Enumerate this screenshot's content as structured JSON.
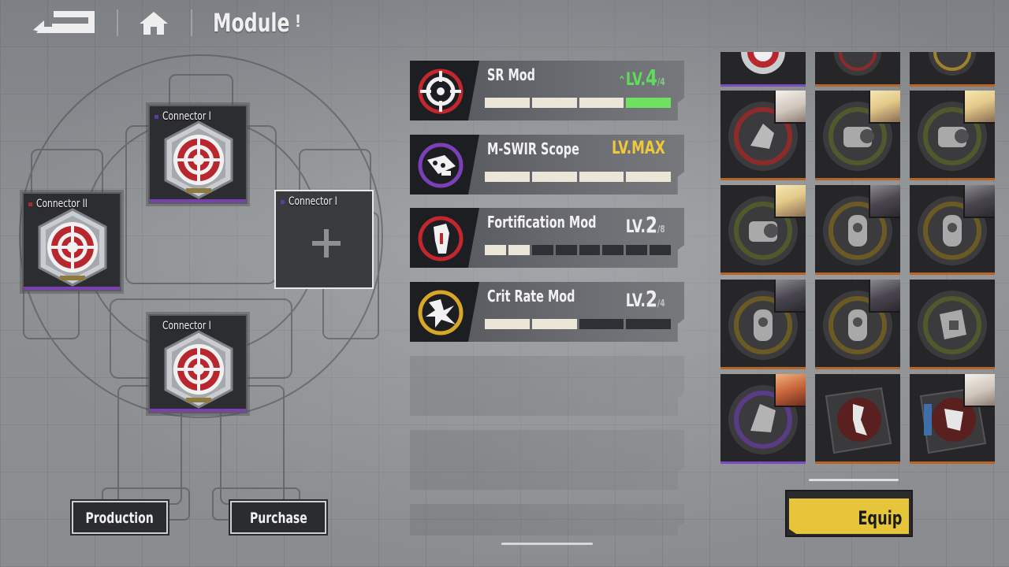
{
  "header": {
    "title": "Module",
    "info": "!"
  },
  "slots": [
    {
      "label": "Connector I",
      "state": "filled"
    },
    {
      "label": "Connector II",
      "state": "filled"
    },
    {
      "label": "Connector I",
      "state": "empty"
    },
    {
      "label": "Connector I",
      "state": "filled"
    }
  ],
  "actions": {
    "production": "Production",
    "purchase": "Purchase"
  },
  "mods": [
    {
      "name": "SR Mod",
      "level_prefix": "LV.",
      "level": "4",
      "level_max": "/4",
      "icon": "target-icon",
      "color": "#5fdc5b",
      "filled": 3,
      "green": 1,
      "total": 4
    },
    {
      "name": "M-SWIR Scope",
      "level_prefix": "LV.",
      "level": "MAX",
      "level_max": "",
      "icon": "scope-icon",
      "color": "#f0c83a",
      "filled": 4,
      "green": 0,
      "total": 4
    },
    {
      "name": "Fortification Mod",
      "level_prefix": "LV.",
      "level": "2",
      "level_max": "/8",
      "icon": "shield-mod-icon",
      "color": "#efefef",
      "filled": 2,
      "green": 0,
      "total": 8
    },
    {
      "name": "Crit Rate Mod",
      "level_prefix": "LV.",
      "level": "2",
      "level_max": "/4",
      "icon": "crit-burst-icon",
      "color": "#efefef",
      "filled": 2,
      "green": 0,
      "total": 4
    }
  ],
  "equip": {
    "label": "Equip"
  },
  "colors": {
    "accent_yellow": "#e6c53a",
    "level_green": "#5fdc5b",
    "rarity_purple": "#7b4bbf",
    "rarity_orange": "#b6652a"
  }
}
